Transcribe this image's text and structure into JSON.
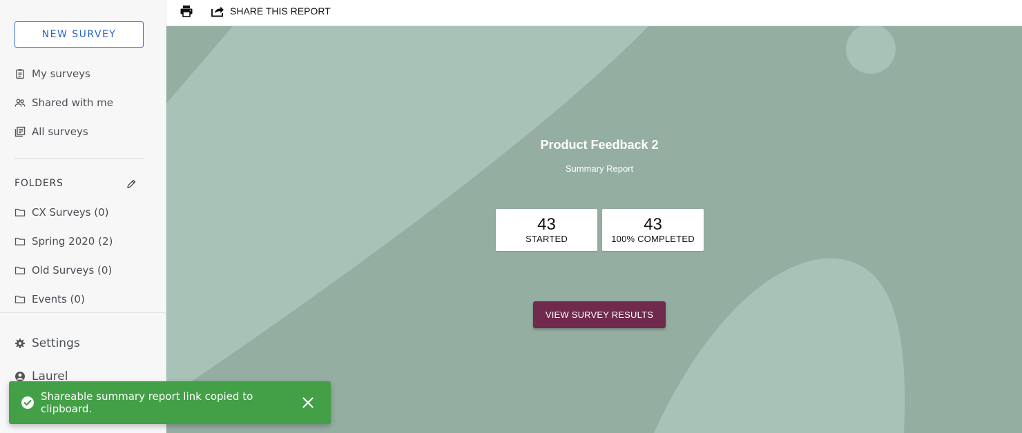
{
  "sidebar": {
    "new_survey_label": "NEW SURVEY",
    "nav": [
      {
        "label": "My surveys",
        "icon": "clipboard-icon"
      },
      {
        "label": "Shared with me",
        "icon": "people-icon"
      },
      {
        "label": "All surveys",
        "icon": "stack-icon"
      }
    ],
    "folders_title": "FOLDERS",
    "folders": [
      {
        "label": "CX Surveys (0)"
      },
      {
        "label": "Spring 2020 (2)"
      },
      {
        "label": "Old Surveys (0)"
      },
      {
        "label": "Events (0)"
      }
    ],
    "settings_label": "Settings",
    "user_label": "Laurel"
  },
  "toolbar": {
    "share_label": "SHARE THIS REPORT"
  },
  "report": {
    "title": "Product Feedback 2",
    "subtitle": "Summary Report",
    "stats": [
      {
        "value": "43",
        "label": "STARTED"
      },
      {
        "value": "43",
        "label": "100% COMPLETED"
      }
    ],
    "view_results_label": "VIEW SURVEY RESULTS"
  },
  "toast": {
    "message": "Shareable summary report link copied to clipboard."
  },
  "colors": {
    "accent_blue": "#2464cc",
    "hero_bg": "#95aea2",
    "hero_shape": "#a8c2b8",
    "button_maroon": "#702a4d",
    "toast_green": "#43a047"
  }
}
